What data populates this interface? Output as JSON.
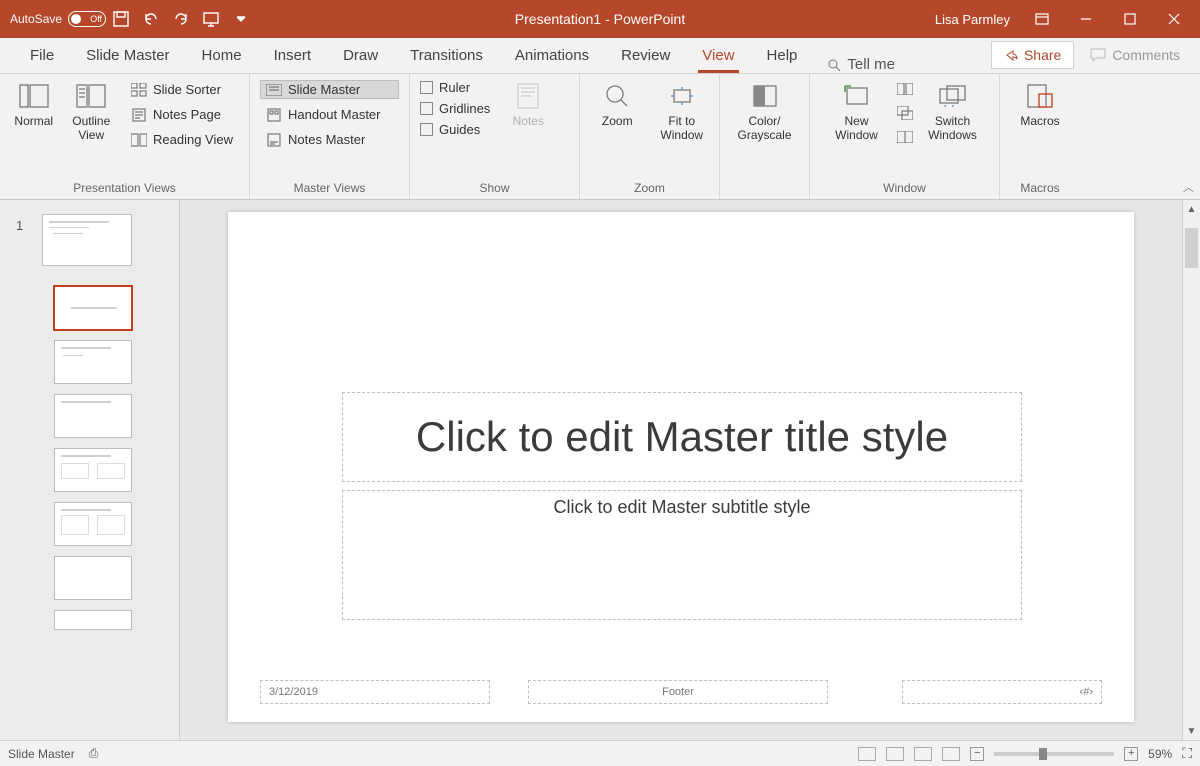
{
  "titlebar": {
    "autosave_label": "AutoSave",
    "autosave_state": "Off",
    "title": "Presentation1  -  PowerPoint",
    "user": "Lisa Parmley"
  },
  "tabs": {
    "items": [
      "File",
      "Slide Master",
      "Home",
      "Insert",
      "Draw",
      "Transitions",
      "Animations",
      "Review",
      "View",
      "Help"
    ],
    "active": "View",
    "tellme": "Tell me",
    "share": "Share",
    "comments": "Comments"
  },
  "ribbon": {
    "presentation_views": {
      "label": "Presentation Views",
      "normal": "Normal",
      "outline": "Outline View",
      "slide_sorter": "Slide Sorter",
      "notes_page": "Notes Page",
      "reading_view": "Reading View"
    },
    "master_views": {
      "label": "Master Views",
      "slide_master": "Slide Master",
      "handout_master": "Handout Master",
      "notes_master": "Notes Master"
    },
    "show": {
      "label": "Show",
      "ruler": "Ruler",
      "gridlines": "Gridlines",
      "guides": "Guides",
      "notes": "Notes"
    },
    "zoom": {
      "label": "Zoom",
      "zoom": "Zoom",
      "fit": "Fit to Window"
    },
    "color": {
      "label": "Color/ Grayscale"
    },
    "window": {
      "label": "Window",
      "new": "New Window",
      "switch": "Switch Windows"
    },
    "macros": {
      "label": "Macros",
      "btn": "Macros"
    }
  },
  "slide": {
    "number": "1",
    "title_ph": "Click to edit Master title style",
    "subtitle_ph": "Click to edit Master subtitle style",
    "date": "3/12/2019",
    "footer": "Footer",
    "num": "‹#›"
  },
  "status": {
    "mode": "Slide Master",
    "zoom": "59%"
  }
}
